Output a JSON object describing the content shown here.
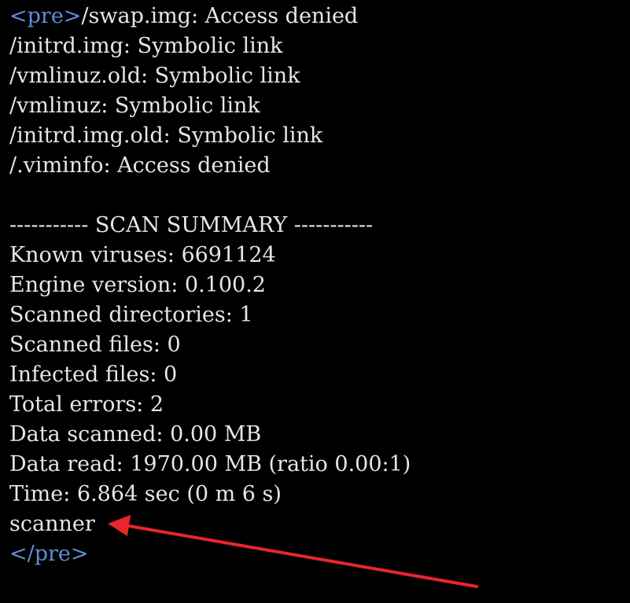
{
  "terminal": {
    "pre_open_tag": "<pre>",
    "lines": [
      "/swap.img: Access denied",
      "/initrd.img: Symbolic link",
      "/vmlinuz.old: Symbolic link",
      "/vmlinuz: Symbolic link",
      "/initrd.img.old: Symbolic link",
      "/.viminfo: Access denied"
    ],
    "summary": {
      "header": "----------- SCAN SUMMARY -----------",
      "known_viruses": "Known viruses: 6691124",
      "engine_version": "Engine version: 0.100.2",
      "scanned_directories": "Scanned directories: 1",
      "scanned_files": "Scanned files: 0",
      "infected_files": "Infected files: 0",
      "total_errors": "Total errors: 2",
      "data_scanned": "Data scanned: 0.00 MB",
      "data_read": "Data read: 1970.00 MB (ratio 0.00:1)",
      "time": "Time: 6.864 sec (0 m 6 s)"
    },
    "scanner_text": "scanner",
    "pre_close_tag": "</pre>"
  },
  "colors": {
    "background": "#000000",
    "text": "#e6e6e6",
    "tag": "#5b8fd6",
    "annotation_arrow": "#e8262b"
  }
}
